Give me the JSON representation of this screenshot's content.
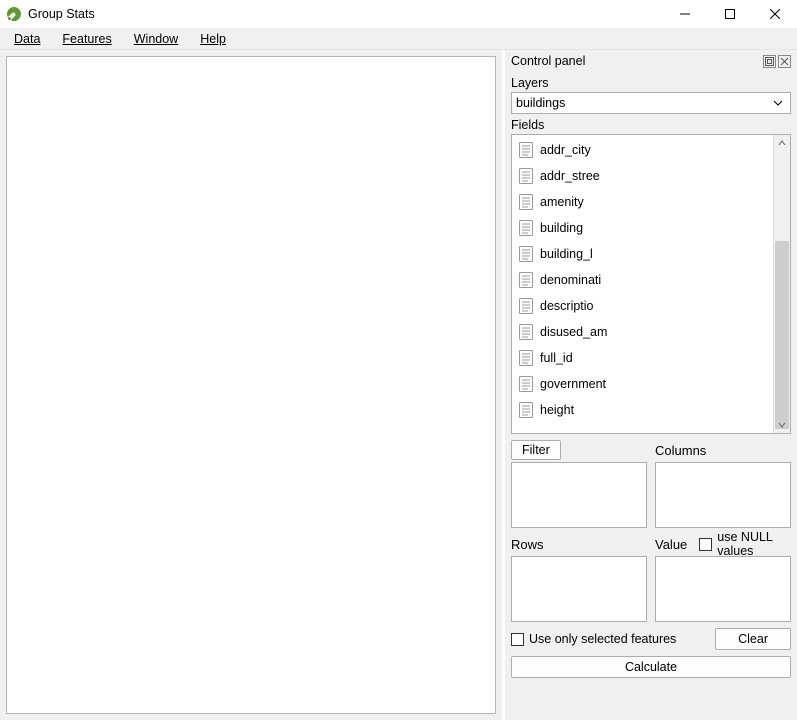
{
  "title": "Group Stats",
  "menu": {
    "data": "Data",
    "features": "Features",
    "window": "Window",
    "help": "Help"
  },
  "panel_title": "Control panel",
  "layers": {
    "label": "Layers",
    "selected": "buildings"
  },
  "fields_label": "Fields",
  "fields": [
    "addr_city",
    "addr_stree",
    "amenity",
    "building",
    "building_l",
    "denominati",
    "descriptio",
    "disused_am",
    "full_id",
    "government",
    "height"
  ],
  "filter_btn": "Filter",
  "columns_label": "Columns",
  "rows_label": "Rows",
  "value_label": "Value",
  "null_label": "use NULL values",
  "only_selected_label": "Use only selected features",
  "clear_btn": "Clear",
  "calculate_btn": "Calculate"
}
